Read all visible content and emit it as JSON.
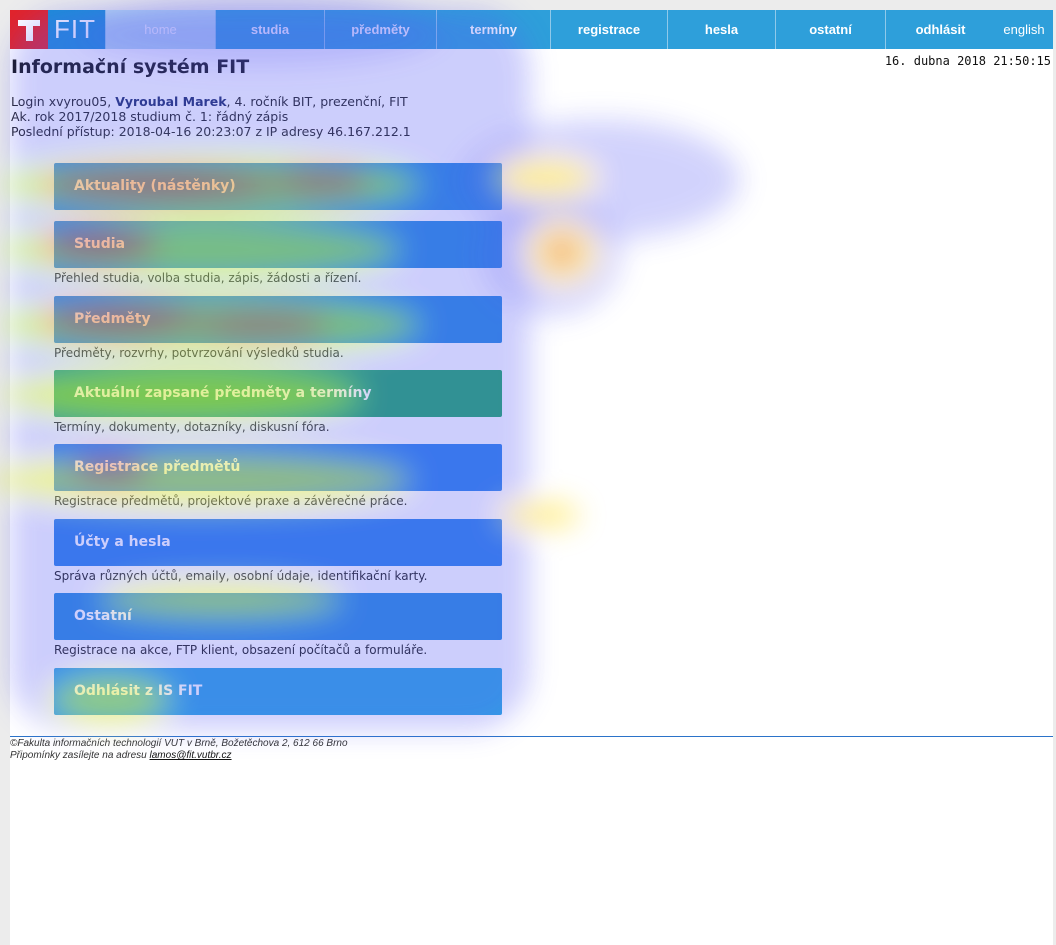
{
  "logo": {
    "text": "FIT",
    "mark": "T"
  },
  "nav": {
    "items": [
      "home",
      "studia",
      "předměty",
      "termíny",
      "registrace",
      "hesla",
      "ostatní",
      "odhlásit",
      "english"
    ]
  },
  "header": {
    "title": "Informační systém FIT",
    "datetime": "16. dubna 2018 21:50:15"
  },
  "user_info": {
    "line1_prefix": "Login xvyrou05,",
    "line1_name": "Vyroubal Marek",
    "line1_suffix": ", 4. ročník BIT, prezenční, FIT",
    "line2": "Ak. rok 2017/2018 studium č. 1: řádný zápis",
    "line3_prefix": "Poslední přístup: 2018-04-16 20:23:07 z IP adresy",
    "line3_ip": "46.167.212.1"
  },
  "menu": [
    {
      "label": "Aktuality (nástěnky)",
      "desc": ""
    },
    {
      "label": "Studia",
      "desc": "Přehled studia, volba studia, zápis, žádosti a řízení."
    },
    {
      "label": "Předměty",
      "desc": "Předměty, rozvrhy, potvrzování výsledků studia."
    },
    {
      "label": "Aktuální zapsané předměty a termíny",
      "desc": "Termíny, dokumenty, dotazníky, diskusní fóra."
    },
    {
      "label": "Registrace předmětů",
      "desc": "Registrace předmětů, projektové praxe a závěrečné práce."
    },
    {
      "label": "Účty a hesla",
      "desc": "Správa různých účtů, emaily, osobní údaje, identifikační karty."
    },
    {
      "label": "Ostatní",
      "desc": "Registrace na akce, FTP klient, obsazení počítačů a formuláře."
    },
    {
      "label": "Odhlásit z IS FIT",
      "desc": ""
    }
  ],
  "footer": {
    "line1": "©Fakulta informačních technologií VUT v Brně, Božetěchova 2, 612 66 Brno",
    "line2_prefix": "Připomínky zasílejte na adresu",
    "email": "lamos@fit.vutbr.cz"
  },
  "colors": {
    "nav_bg": "#2e9fda",
    "logo_red": "#e2232a",
    "menu_blue": "#2a8be0",
    "menu_green": "#22a86a"
  }
}
